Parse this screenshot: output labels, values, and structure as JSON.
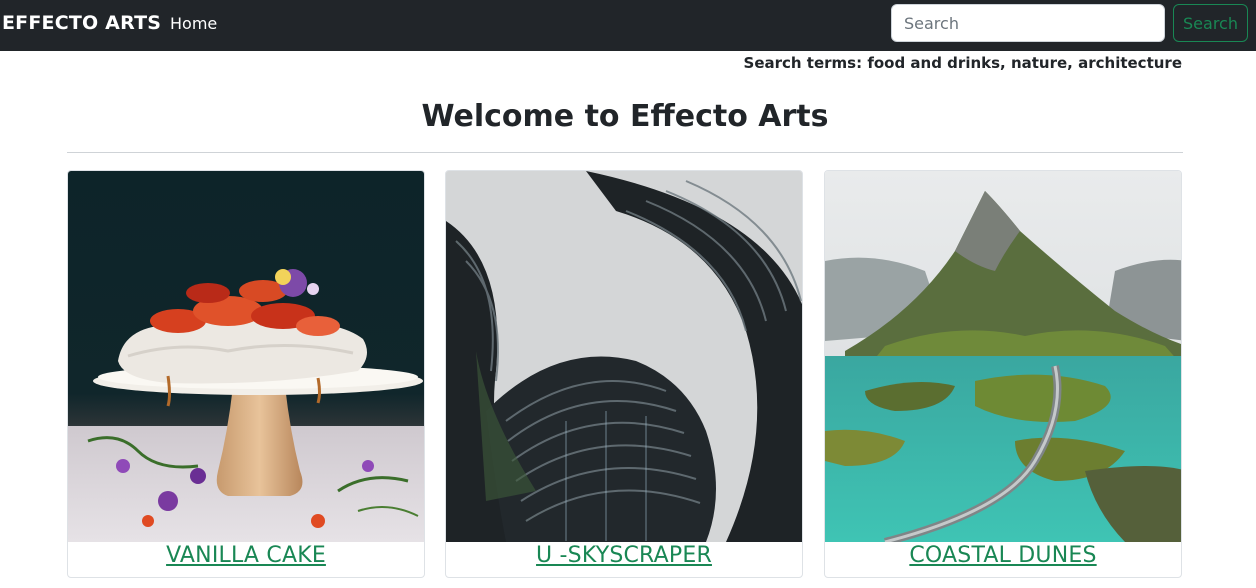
{
  "navbar": {
    "brand": "EFFECTO ARTS",
    "home_label": "Home",
    "search_placeholder": "Search",
    "search_button_label": "Search"
  },
  "search_terms": "Search terms: food and drinks, nature, architecture",
  "page": {
    "title": "Welcome to Effecto Arts"
  },
  "cards": [
    {
      "title": "VANILLA CAKE",
      "image_subject": "pavlova cake on stand with berries and flowers"
    },
    {
      "title": "U -SKYSCRAPER",
      "image_subject": "curved skyscraper viewed from below"
    },
    {
      "title": "COASTAL DUNES",
      "image_subject": "mountain coast with turquoise water and bridge"
    }
  ],
  "colors": {
    "navbar_bg": "#212529",
    "accent_green": "#198754"
  }
}
